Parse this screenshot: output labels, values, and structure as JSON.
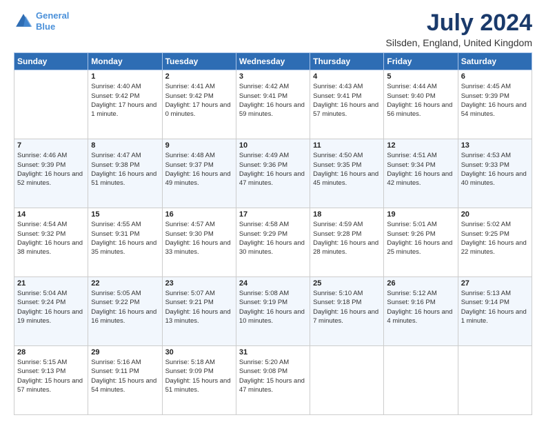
{
  "header": {
    "logo_line1": "General",
    "logo_line2": "Blue",
    "title": "July 2024",
    "subtitle": "Silsden, England, United Kingdom"
  },
  "weekdays": [
    "Sunday",
    "Monday",
    "Tuesday",
    "Wednesday",
    "Thursday",
    "Friday",
    "Saturday"
  ],
  "weeks": [
    [
      {
        "day": "",
        "sunrise": "",
        "sunset": "",
        "daylight": ""
      },
      {
        "day": "1",
        "sunrise": "Sunrise: 4:40 AM",
        "sunset": "Sunset: 9:42 PM",
        "daylight": "Daylight: 17 hours and 1 minute."
      },
      {
        "day": "2",
        "sunrise": "Sunrise: 4:41 AM",
        "sunset": "Sunset: 9:42 PM",
        "daylight": "Daylight: 17 hours and 0 minutes."
      },
      {
        "day": "3",
        "sunrise": "Sunrise: 4:42 AM",
        "sunset": "Sunset: 9:41 PM",
        "daylight": "Daylight: 16 hours and 59 minutes."
      },
      {
        "day": "4",
        "sunrise": "Sunrise: 4:43 AM",
        "sunset": "Sunset: 9:41 PM",
        "daylight": "Daylight: 16 hours and 57 minutes."
      },
      {
        "day": "5",
        "sunrise": "Sunrise: 4:44 AM",
        "sunset": "Sunset: 9:40 PM",
        "daylight": "Daylight: 16 hours and 56 minutes."
      },
      {
        "day": "6",
        "sunrise": "Sunrise: 4:45 AM",
        "sunset": "Sunset: 9:39 PM",
        "daylight": "Daylight: 16 hours and 54 minutes."
      }
    ],
    [
      {
        "day": "7",
        "sunrise": "Sunrise: 4:46 AM",
        "sunset": "Sunset: 9:39 PM",
        "daylight": "Daylight: 16 hours and 52 minutes."
      },
      {
        "day": "8",
        "sunrise": "Sunrise: 4:47 AM",
        "sunset": "Sunset: 9:38 PM",
        "daylight": "Daylight: 16 hours and 51 minutes."
      },
      {
        "day": "9",
        "sunrise": "Sunrise: 4:48 AM",
        "sunset": "Sunset: 9:37 PM",
        "daylight": "Daylight: 16 hours and 49 minutes."
      },
      {
        "day": "10",
        "sunrise": "Sunrise: 4:49 AM",
        "sunset": "Sunset: 9:36 PM",
        "daylight": "Daylight: 16 hours and 47 minutes."
      },
      {
        "day": "11",
        "sunrise": "Sunrise: 4:50 AM",
        "sunset": "Sunset: 9:35 PM",
        "daylight": "Daylight: 16 hours and 45 minutes."
      },
      {
        "day": "12",
        "sunrise": "Sunrise: 4:51 AM",
        "sunset": "Sunset: 9:34 PM",
        "daylight": "Daylight: 16 hours and 42 minutes."
      },
      {
        "day": "13",
        "sunrise": "Sunrise: 4:53 AM",
        "sunset": "Sunset: 9:33 PM",
        "daylight": "Daylight: 16 hours and 40 minutes."
      }
    ],
    [
      {
        "day": "14",
        "sunrise": "Sunrise: 4:54 AM",
        "sunset": "Sunset: 9:32 PM",
        "daylight": "Daylight: 16 hours and 38 minutes."
      },
      {
        "day": "15",
        "sunrise": "Sunrise: 4:55 AM",
        "sunset": "Sunset: 9:31 PM",
        "daylight": "Daylight: 16 hours and 35 minutes."
      },
      {
        "day": "16",
        "sunrise": "Sunrise: 4:57 AM",
        "sunset": "Sunset: 9:30 PM",
        "daylight": "Daylight: 16 hours and 33 minutes."
      },
      {
        "day": "17",
        "sunrise": "Sunrise: 4:58 AM",
        "sunset": "Sunset: 9:29 PM",
        "daylight": "Daylight: 16 hours and 30 minutes."
      },
      {
        "day": "18",
        "sunrise": "Sunrise: 4:59 AM",
        "sunset": "Sunset: 9:28 PM",
        "daylight": "Daylight: 16 hours and 28 minutes."
      },
      {
        "day": "19",
        "sunrise": "Sunrise: 5:01 AM",
        "sunset": "Sunset: 9:26 PM",
        "daylight": "Daylight: 16 hours and 25 minutes."
      },
      {
        "day": "20",
        "sunrise": "Sunrise: 5:02 AM",
        "sunset": "Sunset: 9:25 PM",
        "daylight": "Daylight: 16 hours and 22 minutes."
      }
    ],
    [
      {
        "day": "21",
        "sunrise": "Sunrise: 5:04 AM",
        "sunset": "Sunset: 9:24 PM",
        "daylight": "Daylight: 16 hours and 19 minutes."
      },
      {
        "day": "22",
        "sunrise": "Sunrise: 5:05 AM",
        "sunset": "Sunset: 9:22 PM",
        "daylight": "Daylight: 16 hours and 16 minutes."
      },
      {
        "day": "23",
        "sunrise": "Sunrise: 5:07 AM",
        "sunset": "Sunset: 9:21 PM",
        "daylight": "Daylight: 16 hours and 13 minutes."
      },
      {
        "day": "24",
        "sunrise": "Sunrise: 5:08 AM",
        "sunset": "Sunset: 9:19 PM",
        "daylight": "Daylight: 16 hours and 10 minutes."
      },
      {
        "day": "25",
        "sunrise": "Sunrise: 5:10 AM",
        "sunset": "Sunset: 9:18 PM",
        "daylight": "Daylight: 16 hours and 7 minutes."
      },
      {
        "day": "26",
        "sunrise": "Sunrise: 5:12 AM",
        "sunset": "Sunset: 9:16 PM",
        "daylight": "Daylight: 16 hours and 4 minutes."
      },
      {
        "day": "27",
        "sunrise": "Sunrise: 5:13 AM",
        "sunset": "Sunset: 9:14 PM",
        "daylight": "Daylight: 16 hours and 1 minute."
      }
    ],
    [
      {
        "day": "28",
        "sunrise": "Sunrise: 5:15 AM",
        "sunset": "Sunset: 9:13 PM",
        "daylight": "Daylight: 15 hours and 57 minutes."
      },
      {
        "day": "29",
        "sunrise": "Sunrise: 5:16 AM",
        "sunset": "Sunset: 9:11 PM",
        "daylight": "Daylight: 15 hours and 54 minutes."
      },
      {
        "day": "30",
        "sunrise": "Sunrise: 5:18 AM",
        "sunset": "Sunset: 9:09 PM",
        "daylight": "Daylight: 15 hours and 51 minutes."
      },
      {
        "day": "31",
        "sunrise": "Sunrise: 5:20 AM",
        "sunset": "Sunset: 9:08 PM",
        "daylight": "Daylight: 15 hours and 47 minutes."
      },
      {
        "day": "",
        "sunrise": "",
        "sunset": "",
        "daylight": ""
      },
      {
        "day": "",
        "sunrise": "",
        "sunset": "",
        "daylight": ""
      },
      {
        "day": "",
        "sunrise": "",
        "sunset": "",
        "daylight": ""
      }
    ]
  ]
}
